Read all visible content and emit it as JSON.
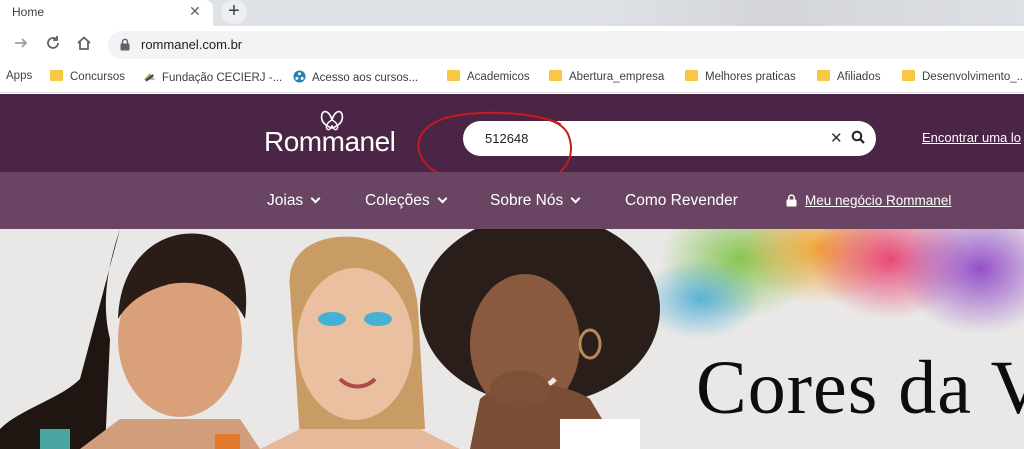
{
  "browser": {
    "tab_title": "Home",
    "tab_close": "✕",
    "new_tab": "+",
    "url": "rommanel.com.br"
  },
  "bookmarks": [
    {
      "label": "Apps",
      "icon": "apps-grid-icon"
    },
    {
      "label": "Concursos",
      "icon": "folder-icon"
    },
    {
      "label": "Fundação CECIERJ -...",
      "icon": "cecierj-icon"
    },
    {
      "label": "Acesso aos cursos...",
      "icon": "course-portal-icon"
    },
    {
      "label": "Academicos",
      "icon": "folder-icon"
    },
    {
      "label": "Abertura_empresa",
      "icon": "folder-icon"
    },
    {
      "label": "Melhores praticas",
      "icon": "folder-icon"
    },
    {
      "label": "Afiliados",
      "icon": "folder-icon"
    },
    {
      "label": "Desenvolvimento_...",
      "icon": "folder-icon"
    }
  ],
  "site": {
    "logo_text": "Rommanel",
    "search_value": "512648",
    "search_clear": "✕",
    "find_store": "Encontrar uma lo",
    "nav": [
      {
        "label": "Joias",
        "has_dropdown": true
      },
      {
        "label": "Coleções",
        "has_dropdown": true
      },
      {
        "label": "Sobre Nós",
        "has_dropdown": true
      },
      {
        "label": "Como Revender",
        "has_dropdown": false
      }
    ],
    "business_link": "Meu negócio Rommanel",
    "hero_text": "Cores da V"
  },
  "colors": {
    "header_bg": "#4a2545",
    "nav_bg": "#6a4563",
    "annotation": "#c8191e"
  }
}
